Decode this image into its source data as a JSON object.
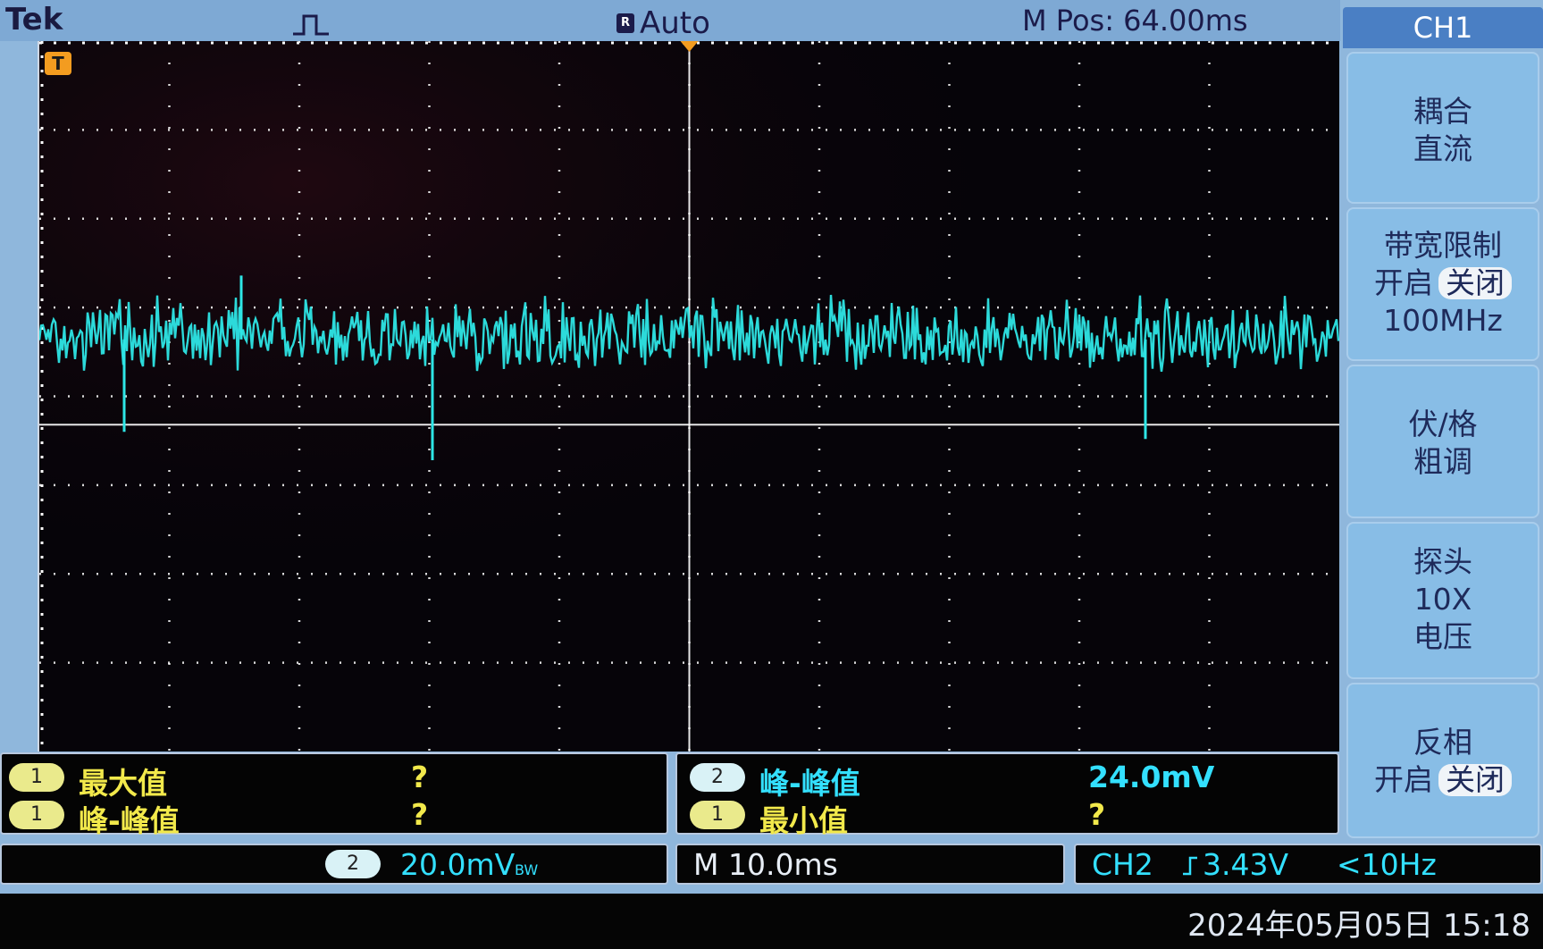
{
  "top": {
    "brand": "Tek",
    "trigger_icon": "pulse-icon",
    "mode": "Auto",
    "m_pos": "M Pos: 64.00ms"
  },
  "screen": {
    "trigger_marker": "T",
    "trace_color": "#2ee6e6",
    "grid_color": "#ffffff"
  },
  "measurements": {
    "left": [
      {
        "channel": "1",
        "label": "最大值",
        "value": "?"
      },
      {
        "channel": "1",
        "label": "峰-峰值",
        "value": "?"
      }
    ],
    "right": [
      {
        "channel": "2",
        "label": "峰-峰值",
        "value": "24.0mV"
      },
      {
        "channel": "1",
        "label": "最小值",
        "value": "?"
      }
    ]
  },
  "status": {
    "ch2_channel": "2",
    "ch2_scale": "20.0mV",
    "ch2_bw": "BW",
    "timebase": "M 10.0ms",
    "trigger_source": "CH2",
    "trigger_slope_icon": "rising-edge-icon",
    "trigger_level": "3.43V",
    "trigger_freq": "<10Hz"
  },
  "datetime": "2024年05月05日 15:18",
  "sidebar": {
    "title": "CH1",
    "coupling": {
      "line1": "耦合",
      "line2": "直流"
    },
    "bandwidth": {
      "line1": "带宽限制",
      "on": "开启",
      "off": "关闭",
      "line3": "100MHz"
    },
    "volts_div": {
      "line1": "伏/格",
      "line2": "粗调"
    },
    "probe": {
      "line1": "探头",
      "line2": "10X",
      "line3": "电压"
    },
    "invert": {
      "line1": "反相",
      "on": "开启",
      "off": "关闭"
    }
  }
}
